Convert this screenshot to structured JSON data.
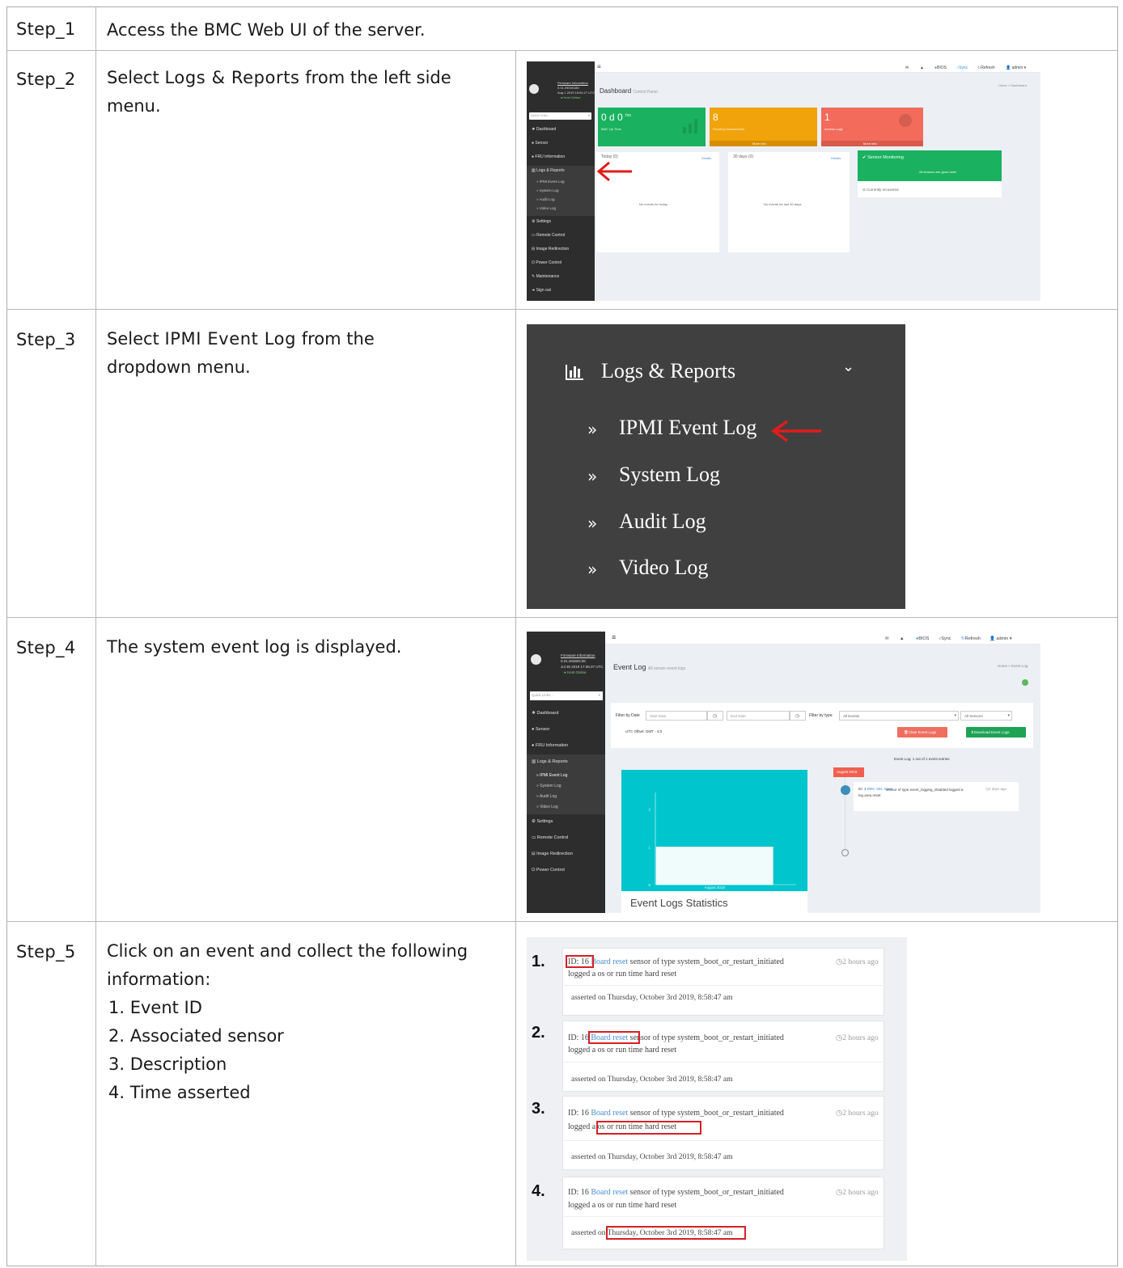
{
  "steps": [
    {
      "label": "Step_1",
      "text": "Access the BMC Web UI of the server."
    },
    {
      "label": "Step_2",
      "text_pre": "Select ",
      "text_strong": "Logs & Reports",
      "text_post": " from the left side menu."
    },
    {
      "label": "Step_3",
      "text_pre": "Select ",
      "text_strong": "IPMI Event Log",
      "text_post": " from the dropdown menu."
    },
    {
      "label": "Step_4",
      "text": "The system event log is displayed."
    },
    {
      "label": "Step_5",
      "text": "Click on an event and collect the following information:",
      "items": [
        "1.  Event ID",
        "2.  Associated sensor",
        "3.  Description",
        "4.  Time asserted"
      ]
    }
  ],
  "dashboard": {
    "fw_title": "Firmware Information",
    "fw_version": "0.01.09000180",
    "fw_date": "Aug 1 2019 16:54:17 UTC",
    "host_status": "Host Online",
    "quick_links": "Quick Links...",
    "menu": [
      "Dashboard",
      "Sensor",
      "FRU Information",
      "Logs & Reports",
      "Settings",
      "Remote Control",
      "Image Redirection",
      "Power Control",
      "Maintenance",
      "Sign out"
    ],
    "submenu": [
      "IPMI Event Log",
      "System Log",
      "Audit Log",
      "Video Log"
    ],
    "topbar": {
      "bios": "BIOS",
      "sync": "Sync",
      "refresh": "Refresh",
      "user": "admin"
    },
    "page_title": "Dashboard",
    "page_subtitle": "Control Panel",
    "breadcrumb": "Home > Dashboard",
    "tiles": [
      {
        "value": "0 d 0",
        "unit": "hrs",
        "label": "BMC Up Time",
        "color": "#1ab160",
        "footer": ""
      },
      {
        "value": "8",
        "unit": "",
        "label": "Pending Deassertions",
        "color": "#f0a30a",
        "footer": "More info"
      },
      {
        "value": "1",
        "unit": "",
        "label": "Access Logs",
        "color": "#f26b5b",
        "footer": "More info"
      }
    ],
    "panels": [
      {
        "title": "Today (0)",
        "link": "Details",
        "empty": "No events for today.."
      },
      {
        "title": "30 days (0)",
        "link": "Details",
        "empty": "No events for last 30 days.."
      }
    ],
    "sensor": {
      "title": "Sensor Monitoring",
      "status": "All sensors are good now!",
      "recovered": "Currently recovered"
    }
  },
  "zoom_menu": {
    "title": "Logs & Reports",
    "items": [
      "IPMI Event Log",
      "System Log",
      "Audit Log",
      "Video Log"
    ]
  },
  "eventlog": {
    "fw_title": "Firmware Information",
    "fw_version": "0.01.00369C38",
    "fw_date": "Jul 30 2019 17:36:37 UTC",
    "host_status": "Host Online",
    "quick_links": "Quick Links...",
    "menu": [
      "Dashboard",
      "Sensor",
      "FRU Information",
      "Logs & Reports",
      "Settings",
      "Remote Control",
      "Image Redirection",
      "Power Control"
    ],
    "submenu": [
      "IPMI Event Log",
      "System Log",
      "Audit Log",
      "Video Log"
    ],
    "topbar": {
      "bios": "BIOS",
      "sync": "Sync",
      "refresh": "Refresh",
      "user": "admin"
    },
    "page_title": "Event Log",
    "page_subtitle": "All sensor event logs",
    "breadcrumb": "Home > Event Log",
    "filter_date_label": "Filter by Date",
    "start_placeholder": "Start Date",
    "end_placeholder": "End Date",
    "filter_type_label": "Filter by type",
    "type_value": "All Events",
    "sensor_value": "All Sensors",
    "utc_offset": "UTC Offset: GMT - 4:0",
    "clear_btn": "Clear Event Logs",
    "download_btn": "Download Event Logs",
    "entries_info": "Event Log: 1 out of 1 event entries",
    "stats_title": "Event Logs Statistics",
    "chart_month": "August 2019",
    "timeline_badge": "August 2019",
    "event_id": "ID: 1",
    "event_sensor": "BMC SEL State",
    "event_desc": " sensor of type event_logging_disabled logged a log area reset",
    "event_ago": "2 days ago"
  },
  "chart_data": {
    "type": "bar",
    "categories": [
      "August 2019"
    ],
    "values": [
      1
    ],
    "title": "",
    "xlabel": "",
    "ylabel": "",
    "ylim": [
      0,
      2
    ],
    "yticks": [
      "0",
      "1",
      "2"
    ]
  },
  "events": [
    {
      "num": "1.",
      "id": "ID: 16",
      "sensor": "Board reset",
      "text": " sensor of type system_boot_or_restart_initiated",
      "line2": "logged a os or run time hard reset",
      "ago": "2 hours ago",
      "asserted": "asserted on Thursday, October 3rd 2019, 8:58:47 am"
    },
    {
      "num": "2.",
      "id": "ID: 16",
      "sensor": "Board reset",
      "text": " sensor of type system_boot_or_restart_initiated",
      "line2": "logged a os or run time hard reset",
      "ago": "2 hours ago",
      "asserted": "asserted on Thursday, October 3rd 2019, 8:58:47 am"
    },
    {
      "num": "3.",
      "id": "ID: 16",
      "sensor": "Board reset",
      "text": " sensor of type system_boot_or_restart_initiated",
      "line2": "logged a os or run time hard reset",
      "ago": "2 hours ago",
      "asserted": "asserted on Thursday, October 3rd 2019, 8:58:47 am"
    },
    {
      "num": "4.",
      "id": "ID: 16",
      "sensor": "Board reset",
      "text": " sensor of type system_boot_or_restart_initiated",
      "line2": "logged a os or run time hard reset",
      "ago": "2 hours ago",
      "asserted": "asserted on Thursday, October 3rd 2019, 8:58:47 am"
    }
  ]
}
